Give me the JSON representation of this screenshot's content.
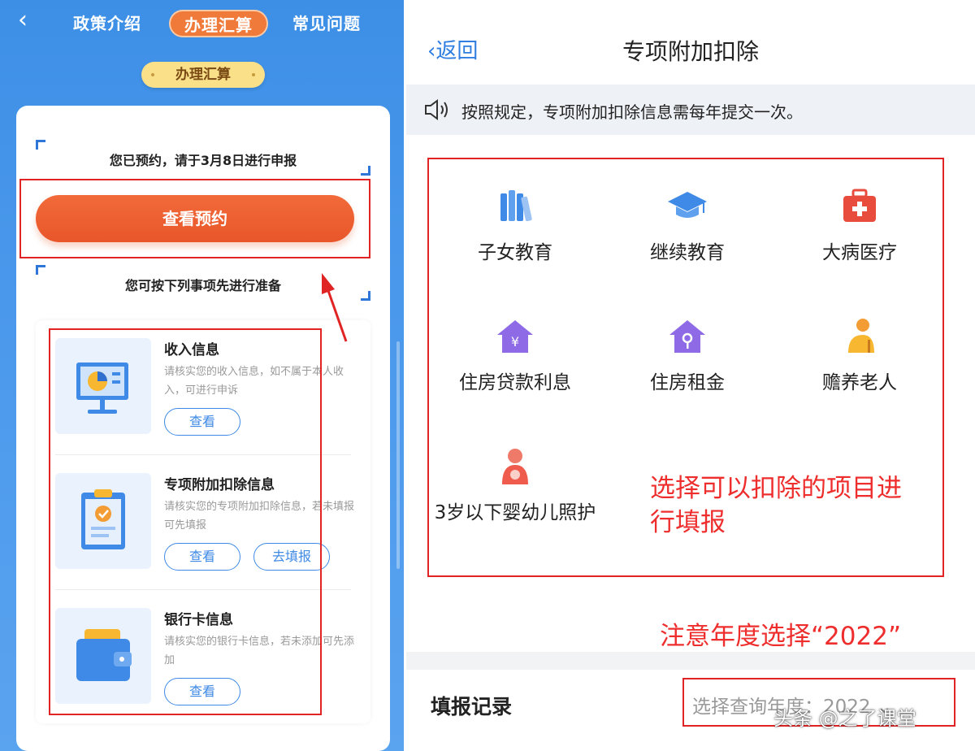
{
  "left": {
    "tabs": [
      "政策介绍",
      "办理汇算",
      "常见问题"
    ],
    "section_pill": "办理汇算",
    "reservation_message": "您已预约，请于3月8日进行申报",
    "view_reservation_button": "查看预约",
    "prepare_message": "您可按下列事项先进行准备",
    "items": [
      {
        "title": "收入信息",
        "desc": "请核实您的收入信息，如不属于本人收入，可进行申诉",
        "buttons": [
          "查看"
        ]
      },
      {
        "title": "专项附加扣除信息",
        "desc": "请核实您的专项附加扣除信息，若未填报可先填报",
        "buttons": [
          "查看",
          "去填报"
        ]
      },
      {
        "title": "银行卡信息",
        "desc": "请核实您的银行卡信息，若未添加可先添加",
        "buttons": [
          "查看"
        ]
      }
    ]
  },
  "right": {
    "back_label": "返回",
    "title": "专项附加扣除",
    "notice": "按照规定，专项附加扣除信息需每年提交一次。",
    "categories": [
      {
        "label": "子女教育",
        "icon": "books-icon"
      },
      {
        "label": "继续教育",
        "icon": "graduation-cap-icon"
      },
      {
        "label": "大病医疗",
        "icon": "medical-kit-icon"
      },
      {
        "label": "住房贷款利息",
        "icon": "house-loan-icon"
      },
      {
        "label": "住房租金",
        "icon": "house-rent-icon"
      },
      {
        "label": "赡养老人",
        "icon": "elderly-icon"
      },
      {
        "label": "3岁以下婴幼儿照护",
        "icon": "infant-care-icon"
      }
    ],
    "annotation_select": "选择可以扣除的项目进行填报",
    "annotation_year": "注意年度选择“2022”",
    "record_title": "填报记录",
    "record_select": "选择查询年度：2022 ⌄",
    "watermark": "头条 @之了课堂"
  },
  "colors": {
    "primary_blue": "#3f8ae6",
    "accent_orange": "#ef6a3a",
    "annotation_red": "#e02424"
  }
}
